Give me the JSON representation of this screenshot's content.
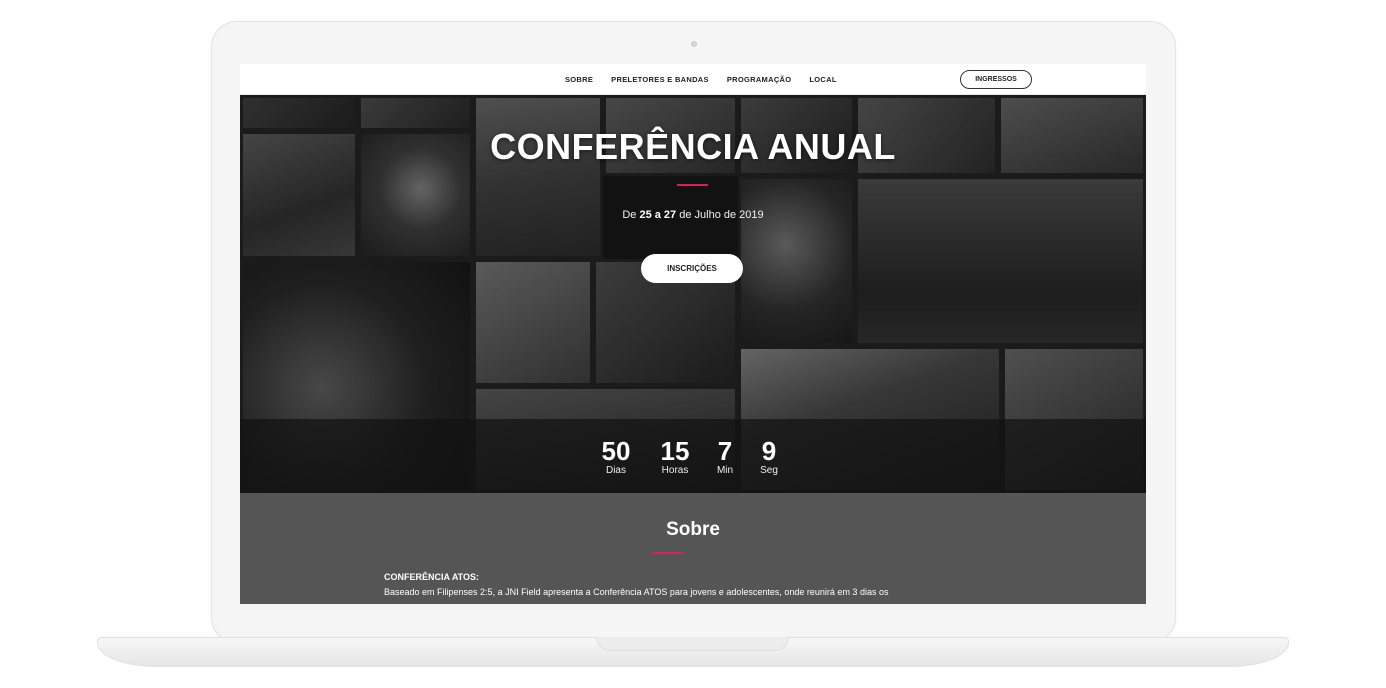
{
  "nav": {
    "links": [
      "SOBRE",
      "PRELETORES E BANDAS",
      "PROGRAMAÇÃO",
      "LOCAL"
    ],
    "cta": "INGRESSOS"
  },
  "hero": {
    "title": "CONFERÊNCIA ANUAL",
    "date_prefix": "De",
    "date_range": "25 a 27",
    "date_suffix": "de Julho de 2019",
    "button": "INSCRIÇÕES",
    "accent_color": "#d6205f"
  },
  "countdown": [
    {
      "value": "50",
      "label": "Dias"
    },
    {
      "value": "15",
      "label": "Horas"
    },
    {
      "value": "7",
      "label": "Min"
    },
    {
      "value": "9",
      "label": "Seg"
    }
  ],
  "about": {
    "title": "Sobre",
    "heading": "CONFERÊNCIA ATOS:",
    "text": "Baseado em Filipenses 2:5, a JNI Field apresenta a Conferência ATOS para jovens e adolescentes, onde reunirá em 3 dias os"
  }
}
